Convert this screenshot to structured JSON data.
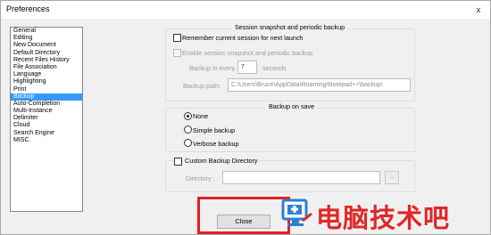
{
  "window": {
    "title": "Preferences",
    "close_label": "x"
  },
  "categories": [
    {
      "label": "General",
      "selected": false
    },
    {
      "label": "Editing",
      "selected": false
    },
    {
      "label": "New Document",
      "selected": false
    },
    {
      "label": "Default Directory",
      "selected": false
    },
    {
      "label": "Recent Files History",
      "selected": false
    },
    {
      "label": "File Association",
      "selected": false
    },
    {
      "label": "Language",
      "selected": false
    },
    {
      "label": "Highlighting",
      "selected": false
    },
    {
      "label": "Print",
      "selected": false
    },
    {
      "label": "Backup",
      "selected": true
    },
    {
      "label": "Auto-Completion",
      "selected": false
    },
    {
      "label": "Multi-Instance",
      "selected": false
    },
    {
      "label": "Delimiter",
      "selected": false
    },
    {
      "label": "Cloud",
      "selected": false
    },
    {
      "label": "Search Engine",
      "selected": false
    },
    {
      "label": "MISC.",
      "selected": false
    }
  ],
  "session": {
    "group_title": "Session snapshot and periodic backup",
    "remember_label": "Remember current session for next launch",
    "remember_checked": false,
    "enable_label": "Enable session snapshot and periodic backup",
    "enable_checked": false,
    "backup_every_label": "Backup in every",
    "backup_every_value": "7",
    "seconds_label": "seconds",
    "path_label": "Backup path:",
    "path_value": "C:\\Users\\Bruce\\AppData\\Roaming\\Notepad++\\backup\\"
  },
  "backup_on_save": {
    "group_title": "Backup on save",
    "options": [
      {
        "label": "None",
        "checked": true
      },
      {
        "label": "Simple backup",
        "checked": false
      },
      {
        "label": "Verbose backup",
        "checked": false
      }
    ],
    "custom_dir_label": "Custom Backup Directory",
    "custom_dir_checked": false,
    "directory_label": "Directory :",
    "directory_value": "",
    "browse_label": "..."
  },
  "footer": {
    "close_label": "Close"
  },
  "watermark": {
    "text": "电脑技术吧",
    "accent": "#e02727"
  }
}
